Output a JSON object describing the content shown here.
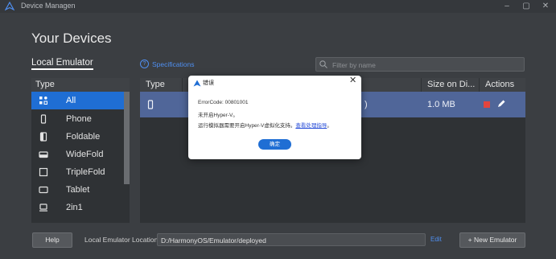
{
  "window": {
    "title": "Device Managen",
    "minimize": "–",
    "maximize": "▢",
    "close": "✕"
  },
  "page": {
    "title": "Your Devices",
    "tab_local_emulator": "Local Emulator",
    "specs_link": "Specifications",
    "search_placeholder": "Filter by name"
  },
  "type_panel": {
    "header": "Type",
    "items": [
      {
        "label": "All",
        "icon": "grid-icon",
        "selected": true
      },
      {
        "label": "Phone",
        "icon": "phone-icon"
      },
      {
        "label": "Foldable",
        "icon": "foldable-icon"
      },
      {
        "label": "WideFold",
        "icon": "widefold-icon"
      },
      {
        "label": "TripleFold",
        "icon": "triplefold-icon"
      },
      {
        "label": "Tablet",
        "icon": "tablet-icon"
      },
      {
        "label": "2in1",
        "icon": "laptop-icon"
      }
    ]
  },
  "device_table": {
    "columns": [
      "Type",
      "",
      "Size on Di...",
      "Actions"
    ],
    "rows": [
      {
        "type_icon": "phone-icon",
        "status_partial": ")",
        "size": "1.0 MB"
      }
    ]
  },
  "bottom": {
    "help": "Help",
    "location_label": "Local Emulator Location:",
    "location_value": "D:/HarmonyOS/Emulator/deployed",
    "edit": "Edit",
    "new_emulator": "+ New Emulator"
  },
  "dialog": {
    "title": "错误",
    "error_code": "ErrorCode: 00801001",
    "message1": "未开启Hyper-V。",
    "message2": "运行模拟器需要开启Hyper-V虚拟化支持。",
    "guide_link": "查看处理指导",
    "guide_suffix": "。",
    "ok": "确定",
    "close": "✕"
  },
  "colors": {
    "accent": "#1f6ed4",
    "link": "#4f8ff0",
    "selected_row": "#506699",
    "stop": "#e2453e",
    "background": "#3b3e42"
  }
}
